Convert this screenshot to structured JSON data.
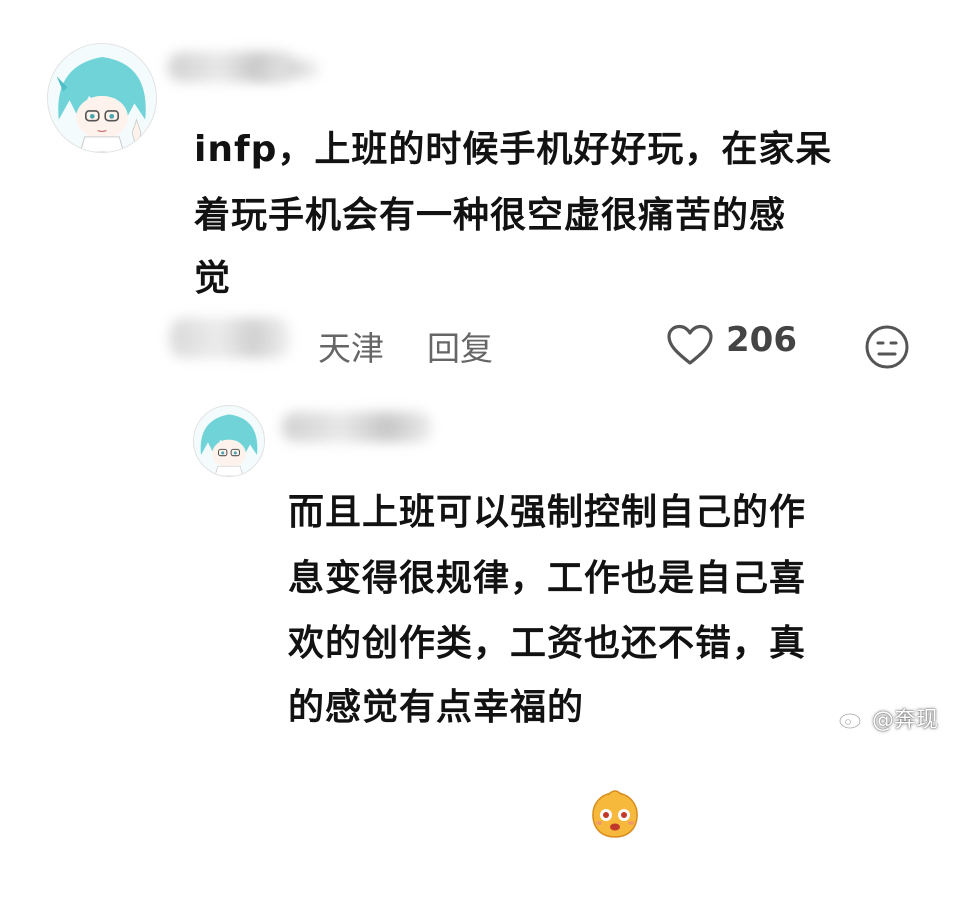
{
  "comment": {
    "text_line1": "infp，上班的时候手机好好玩，在家呆",
    "text_line2": "着玩手机会有一种很空虚很痛苦的感",
    "text_line3": "觉",
    "location": "天津",
    "reply_label": "回复",
    "like_count": "206"
  },
  "reply": {
    "text_line1": "而且上班可以强制控制自己的作",
    "text_line2": "息变得很规律，工作也是自己喜",
    "text_line3": "欢的创作类，工资也还不错，真",
    "text_line4": "的感觉有点幸福的",
    "emoji_icon": "happy-face-emoji"
  },
  "watermark": {
    "text": "@奔现"
  },
  "colors": {
    "text": "#121212",
    "meta": "#666666",
    "avatar_hair": "#6fd3d8",
    "emoji": "#f6b93b"
  }
}
